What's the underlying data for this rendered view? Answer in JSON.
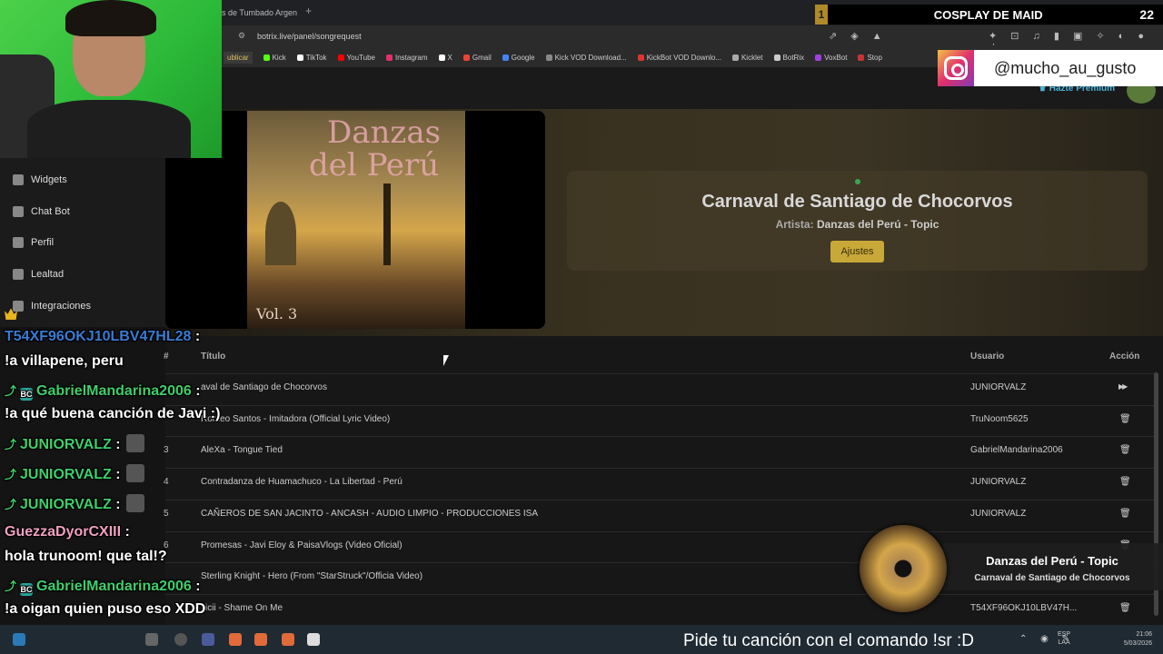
{
  "browser": {
    "tab_title": "s de Tumbado Argen",
    "url": "botrix.live/panel/songrequest",
    "bookmarks": [
      {
        "label": "ublicar",
        "color": "#e0c060"
      },
      {
        "label": "Kick",
        "color": "#53fc18"
      },
      {
        "label": "TikTok",
        "color": "#ffffff"
      },
      {
        "label": "YouTube",
        "color": "#ff0000"
      },
      {
        "label": "Instagram",
        "color": "#e1306c"
      },
      {
        "label": "X",
        "color": "#ffffff"
      },
      {
        "label": "Gmail",
        "color": "#ea4335"
      },
      {
        "label": "Google",
        "color": "#4285f4"
      },
      {
        "label": "Kick VOD Download...",
        "color": "#888888"
      },
      {
        "label": "KickBot VOD Downlo...",
        "color": "#d33"
      },
      {
        "label": "Kicklet",
        "color": "#aaa"
      },
      {
        "label": "BotRix",
        "color": "#ccc"
      },
      {
        "label": "VoxBot",
        "color": "#a040e0"
      },
      {
        "label": "Stop",
        "color": "#c33"
      }
    ]
  },
  "header": {
    "premium_label": "Hazte Premium"
  },
  "sidebar": {
    "items": [
      {
        "label": "Widgets",
        "icon": "widgets-icon"
      },
      {
        "label": "Chat Bot",
        "icon": "robot-icon"
      },
      {
        "label": "Perfil",
        "icon": "profile-icon"
      },
      {
        "label": "Lealtad",
        "icon": "trophy-icon"
      },
      {
        "label": "Integraciones",
        "icon": "integrations-icon"
      }
    ]
  },
  "now_playing": {
    "album_title_line1": "Danzas",
    "album_title_line2": "del Perú",
    "album_vol": "Vol. 3",
    "title": "Carnaval de Santiago de Chocorvos",
    "artist_label": "Artista:",
    "artist": "Danzas del Perú - Topic",
    "settings_button": "Ajustes"
  },
  "queue": {
    "headers": {
      "num": "#",
      "title": "Título",
      "user": "Usuario",
      "action": "Acción"
    },
    "rows": [
      {
        "num": "",
        "title": "aval de Santiago de Chocorvos",
        "user": "JUNIORVALZ",
        "action": "skip"
      },
      {
        "num": "",
        "title": "Romeo Santos - Imitadora (Official Lyric Video)",
        "user": "TruNoom5625",
        "action": "delete"
      },
      {
        "num": "3",
        "title": "AleXa - Tongue Tied",
        "user": "GabrielMandarina2006",
        "action": "delete"
      },
      {
        "num": "4",
        "title": "Contradanza de Huamachuco - La Libertad - Perú",
        "user": "JUNIORVALZ",
        "action": "delete"
      },
      {
        "num": "5",
        "title": "CAÑEROS DE SAN JACINTO - ANCASH - AUDIO LIMPIO - PRODUCCIONES ISA",
        "user": "JUNIORVALZ",
        "action": "delete"
      },
      {
        "num": "6",
        "title": "Promesas - Javi Eloy & PaisaVlogs (Video Oficial)",
        "user": "",
        "action": "delete"
      },
      {
        "num": "",
        "title": "Sterling Knight - Hero (From \"StarStruck\"/Officia Video)",
        "user": "",
        "action": ""
      },
      {
        "num": "",
        "title": "vicii - Shame On Me",
        "user": "T54XF96OKJ10LBV47H...",
        "action": "delete"
      }
    ]
  },
  "overlay": {
    "goal_index": "1",
    "goal_title": "COSPLAY DE MAID",
    "goal_count": "22",
    "instagram_handle": "@mucho_au_gusto",
    "popup_artist": "Danzas del Perú - Topic",
    "popup_song": "Carnaval de Santiago de Chocorvos",
    "sr_banner": "Pide tu canción con el comando !sr :D"
  },
  "chat": [
    {
      "user": "T54XF96OKJ10LBV47HL28",
      "color": "#3a7bd5",
      "badge": "crown",
      "message": "!a villapene, peru"
    },
    {
      "user": "GabrielMandarina2006",
      "color": "#3ecf6a",
      "badge": "bot",
      "message": "!a qué buena canción de Javi :)"
    },
    {
      "user": "JUNIORVALZ",
      "color": "#3ecf6a",
      "badge": "arrow",
      "message": ""
    },
    {
      "user": "JUNIORVALZ",
      "color": "#3ecf6a",
      "badge": "arrow",
      "message": ""
    },
    {
      "user": "JUNIORVALZ",
      "color": "#3ecf6a",
      "badge": "arrow",
      "message": ""
    },
    {
      "user": "GuezzaDyorCXIII",
      "color": "#f0a0c0",
      "badge": "",
      "message": "hola trunoom! que tal!?"
    },
    {
      "user": "GabrielMandarina2006",
      "color": "#3ecf6a",
      "badge": "bot",
      "message": "!a oigan quien puso eso XDD"
    },
    {
      "user": "JUNIORVALZ",
      "color": "#3ecf6a",
      "badge": "arrow",
      "message": ""
    }
  ],
  "taskbar": {
    "lang_line1": "ESP",
    "lang_line2": "LAA",
    "time": "21:06",
    "date": "5/03/2026"
  }
}
